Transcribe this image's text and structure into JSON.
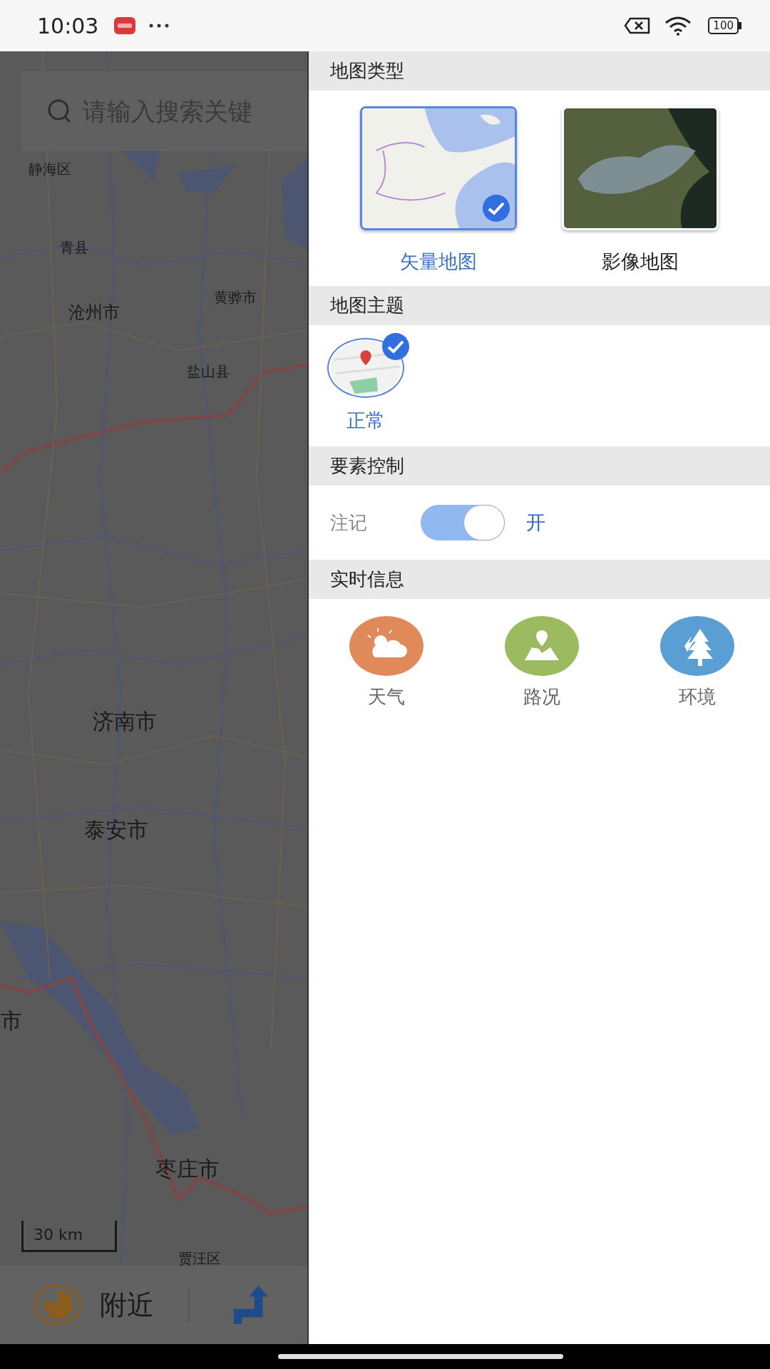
{
  "status_bar": {
    "time": "10:03",
    "battery": "100"
  },
  "map": {
    "search": {
      "placeholder": "请输入搜索关键"
    },
    "labels": [
      {
        "text": "静海区",
        "kind": "small"
      },
      {
        "text": "青县",
        "kind": "small"
      },
      {
        "text": "沧州市",
        "kind": "medium"
      },
      {
        "text": "黄骅市",
        "kind": "small"
      },
      {
        "text": "盐山县",
        "kind": "small"
      },
      {
        "text": "济南市",
        "kind": "large"
      },
      {
        "text": "泰安市",
        "kind": "large"
      },
      {
        "text": "市",
        "kind": "large"
      },
      {
        "text": "枣庄市",
        "kind": "large"
      },
      {
        "text": "贾汪区",
        "kind": "small"
      }
    ],
    "scale": "30 km",
    "bottom_bar": {
      "nearby": "附近"
    }
  },
  "panel": {
    "sections": [
      {
        "title": "地图类型",
        "kind": "map_types",
        "options": [
          {
            "label": "矢量地图",
            "kind": "vector",
            "selected": true
          },
          {
            "label": "影像地图",
            "kind": "satellite",
            "selected": false
          }
        ]
      },
      {
        "title": "地图主题",
        "kind": "themes",
        "options": [
          {
            "label": "正常",
            "selected": true
          }
        ]
      },
      {
        "title": "要素控制",
        "kind": "toggles",
        "toggles": [
          {
            "label": "注记",
            "on": true,
            "state_text": "开"
          }
        ]
      },
      {
        "title": "实时信息",
        "kind": "realtime",
        "items": [
          {
            "label": "天气",
            "kind": "weather",
            "color": "#e08a5a"
          },
          {
            "label": "路况",
            "kind": "traffic",
            "color": "#9cbb60"
          },
          {
            "label": "环境",
            "kind": "environment",
            "color": "#5a9fd4"
          }
        ]
      }
    ]
  }
}
